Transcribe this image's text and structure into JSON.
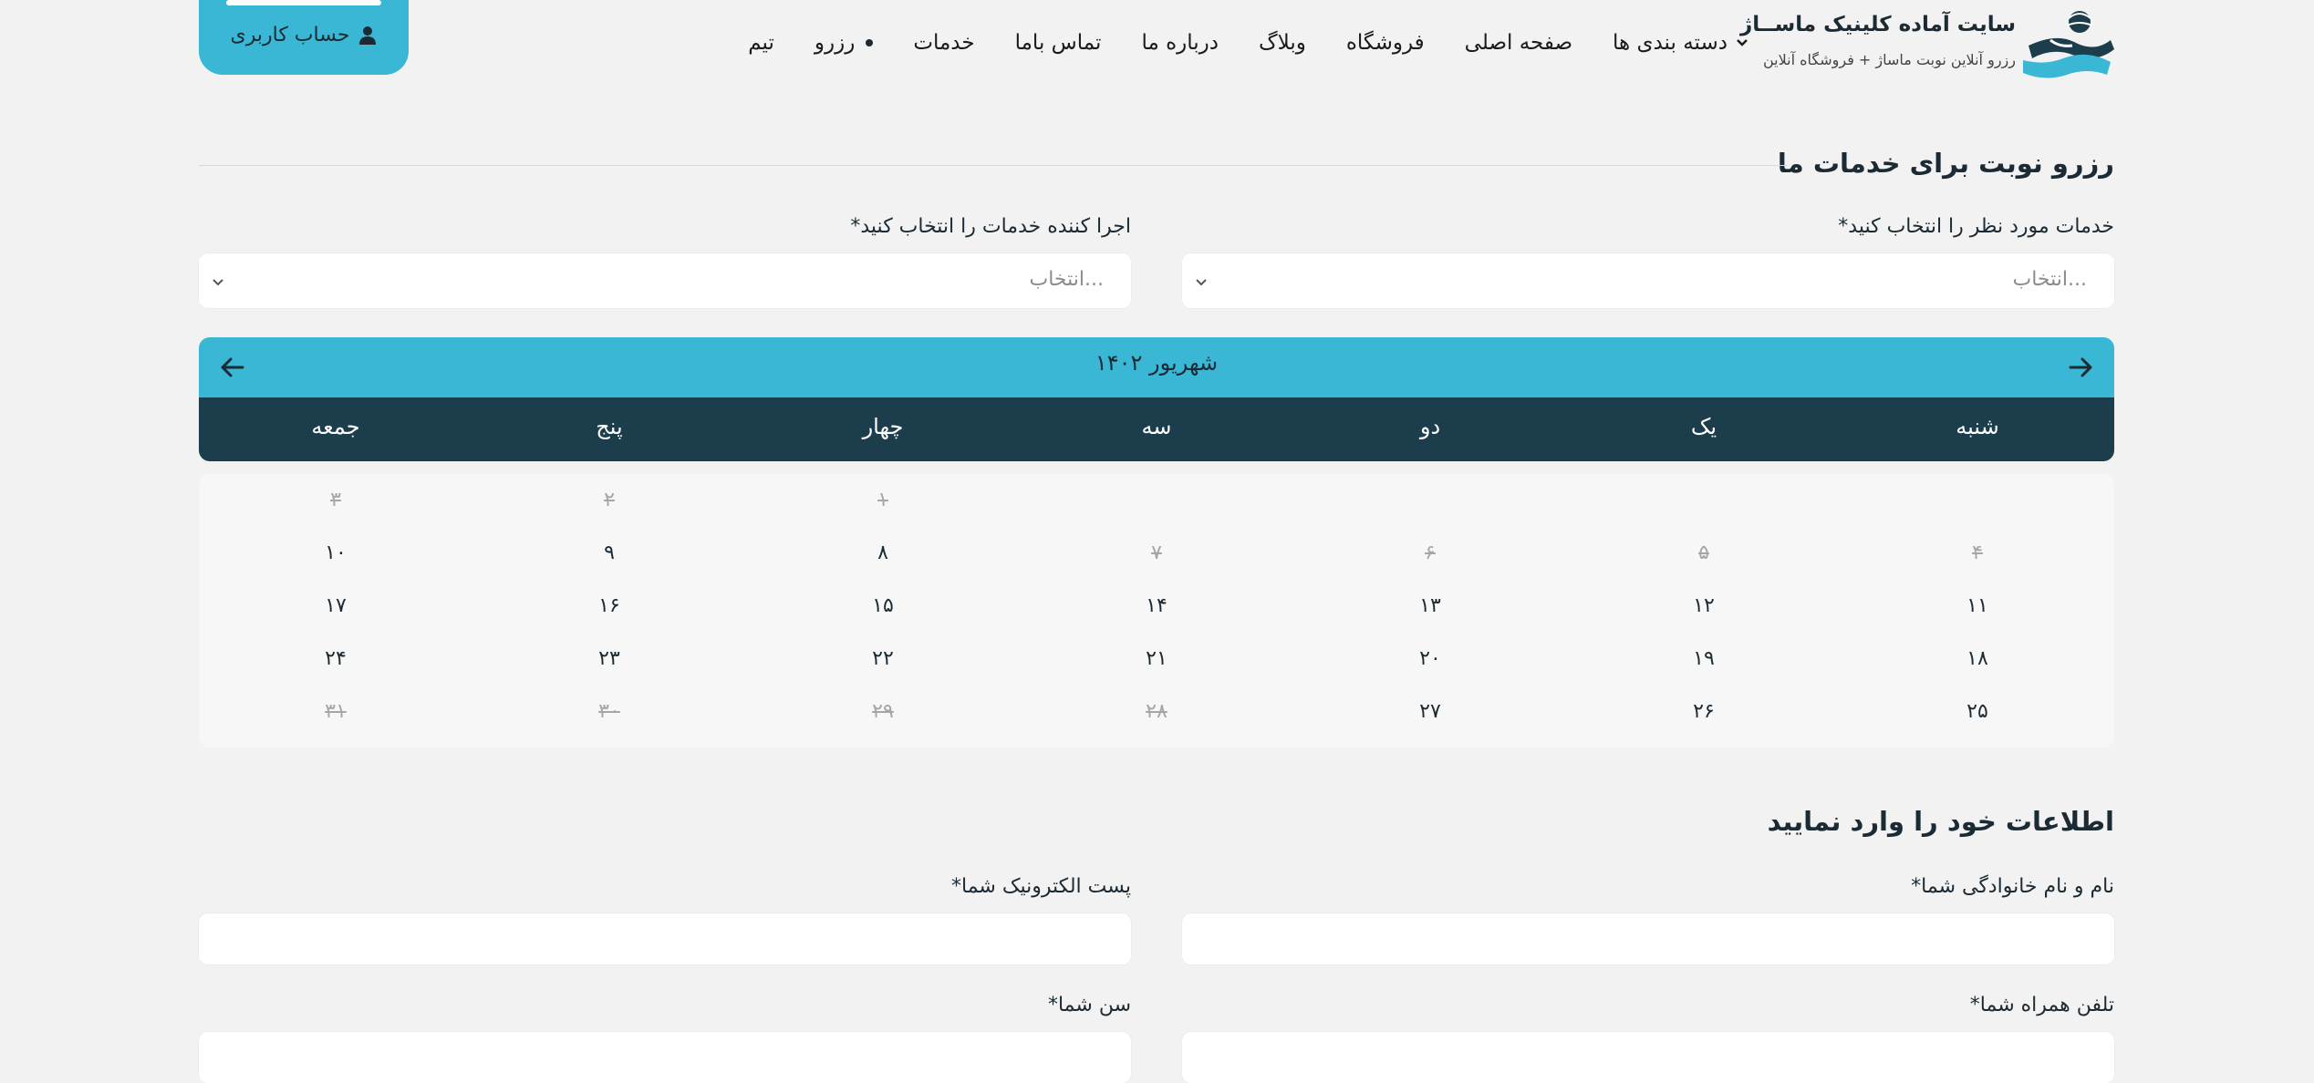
{
  "header": {
    "site_title": "سایت آماده کلینیک ماســاژ",
    "site_subtitle": "رزرو آنلاین نوبت ماساژ + فروشگاه آنلاین",
    "nav": [
      {
        "label": "دسته بندی ها",
        "has_dropdown": true
      },
      {
        "label": "صفحه اصلی"
      },
      {
        "label": "فروشگاه"
      },
      {
        "label": "وبلاگ"
      },
      {
        "label": "درباره ما"
      },
      {
        "label": "تماس باما"
      },
      {
        "label": "خدمات"
      },
      {
        "label": "رزرو",
        "active": true
      },
      {
        "label": "تیم"
      }
    ],
    "account_label": "حساب کاربری"
  },
  "booking": {
    "title": "رزرو نوبت برای خدمات ما",
    "service_label": "خدمات مورد نظر را انتخاب کنید*",
    "service_placeholder": "انتخاب...",
    "provider_label": "اجرا کننده خدمات را انتخاب کنید*",
    "provider_placeholder": "انتخاب..."
  },
  "calendar": {
    "month": "شهریور ۱۴۰۲",
    "weekdays": [
      "شنبه",
      "یک",
      "دو",
      "سه",
      "چهار",
      "پنج",
      "جمعه"
    ],
    "weeks": [
      [
        null,
        null,
        null,
        null,
        {
          "d": "۱",
          "off": true
        },
        {
          "d": "۲",
          "off": true
        },
        {
          "d": "۳",
          "off": true
        }
      ],
      [
        {
          "d": "۴",
          "off": true
        },
        {
          "d": "۵",
          "off": true
        },
        {
          "d": "۶",
          "off": true
        },
        {
          "d": "۷",
          "off": true
        },
        {
          "d": "۸"
        },
        {
          "d": "۹"
        },
        {
          "d": "۱۰"
        }
      ],
      [
        {
          "d": "۱۱"
        },
        {
          "d": "۱۲"
        },
        {
          "d": "۱۳"
        },
        {
          "d": "۱۴"
        },
        {
          "d": "۱۵"
        },
        {
          "d": "۱۶"
        },
        {
          "d": "۱۷"
        }
      ],
      [
        {
          "d": "۱۸"
        },
        {
          "d": "۱۹"
        },
        {
          "d": "۲۰"
        },
        {
          "d": "۲۱"
        },
        {
          "d": "۲۲"
        },
        {
          "d": "۲۳"
        },
        {
          "d": "۲۴"
        }
      ],
      [
        {
          "d": "۲۵"
        },
        {
          "d": "۲۶"
        },
        {
          "d": "۲۷"
        },
        {
          "d": "۲۸",
          "off": true
        },
        {
          "d": "۲۹",
          "off": true
        },
        {
          "d": "۳۰",
          "off": true
        },
        {
          "d": "۳۱",
          "off": true
        }
      ]
    ]
  },
  "personal": {
    "title": "اطلاعات خود را وارد نمایید",
    "name_label": "نام و نام خانوادگی شما*",
    "email_label": "پست الکترونیک شما*",
    "phone_label": "تلفن همراه شما*",
    "age_label": "سن شما*"
  },
  "colors": {
    "accent": "#3ab7d4",
    "dark": "#1c3e4c",
    "background": "#f2f2f2"
  }
}
